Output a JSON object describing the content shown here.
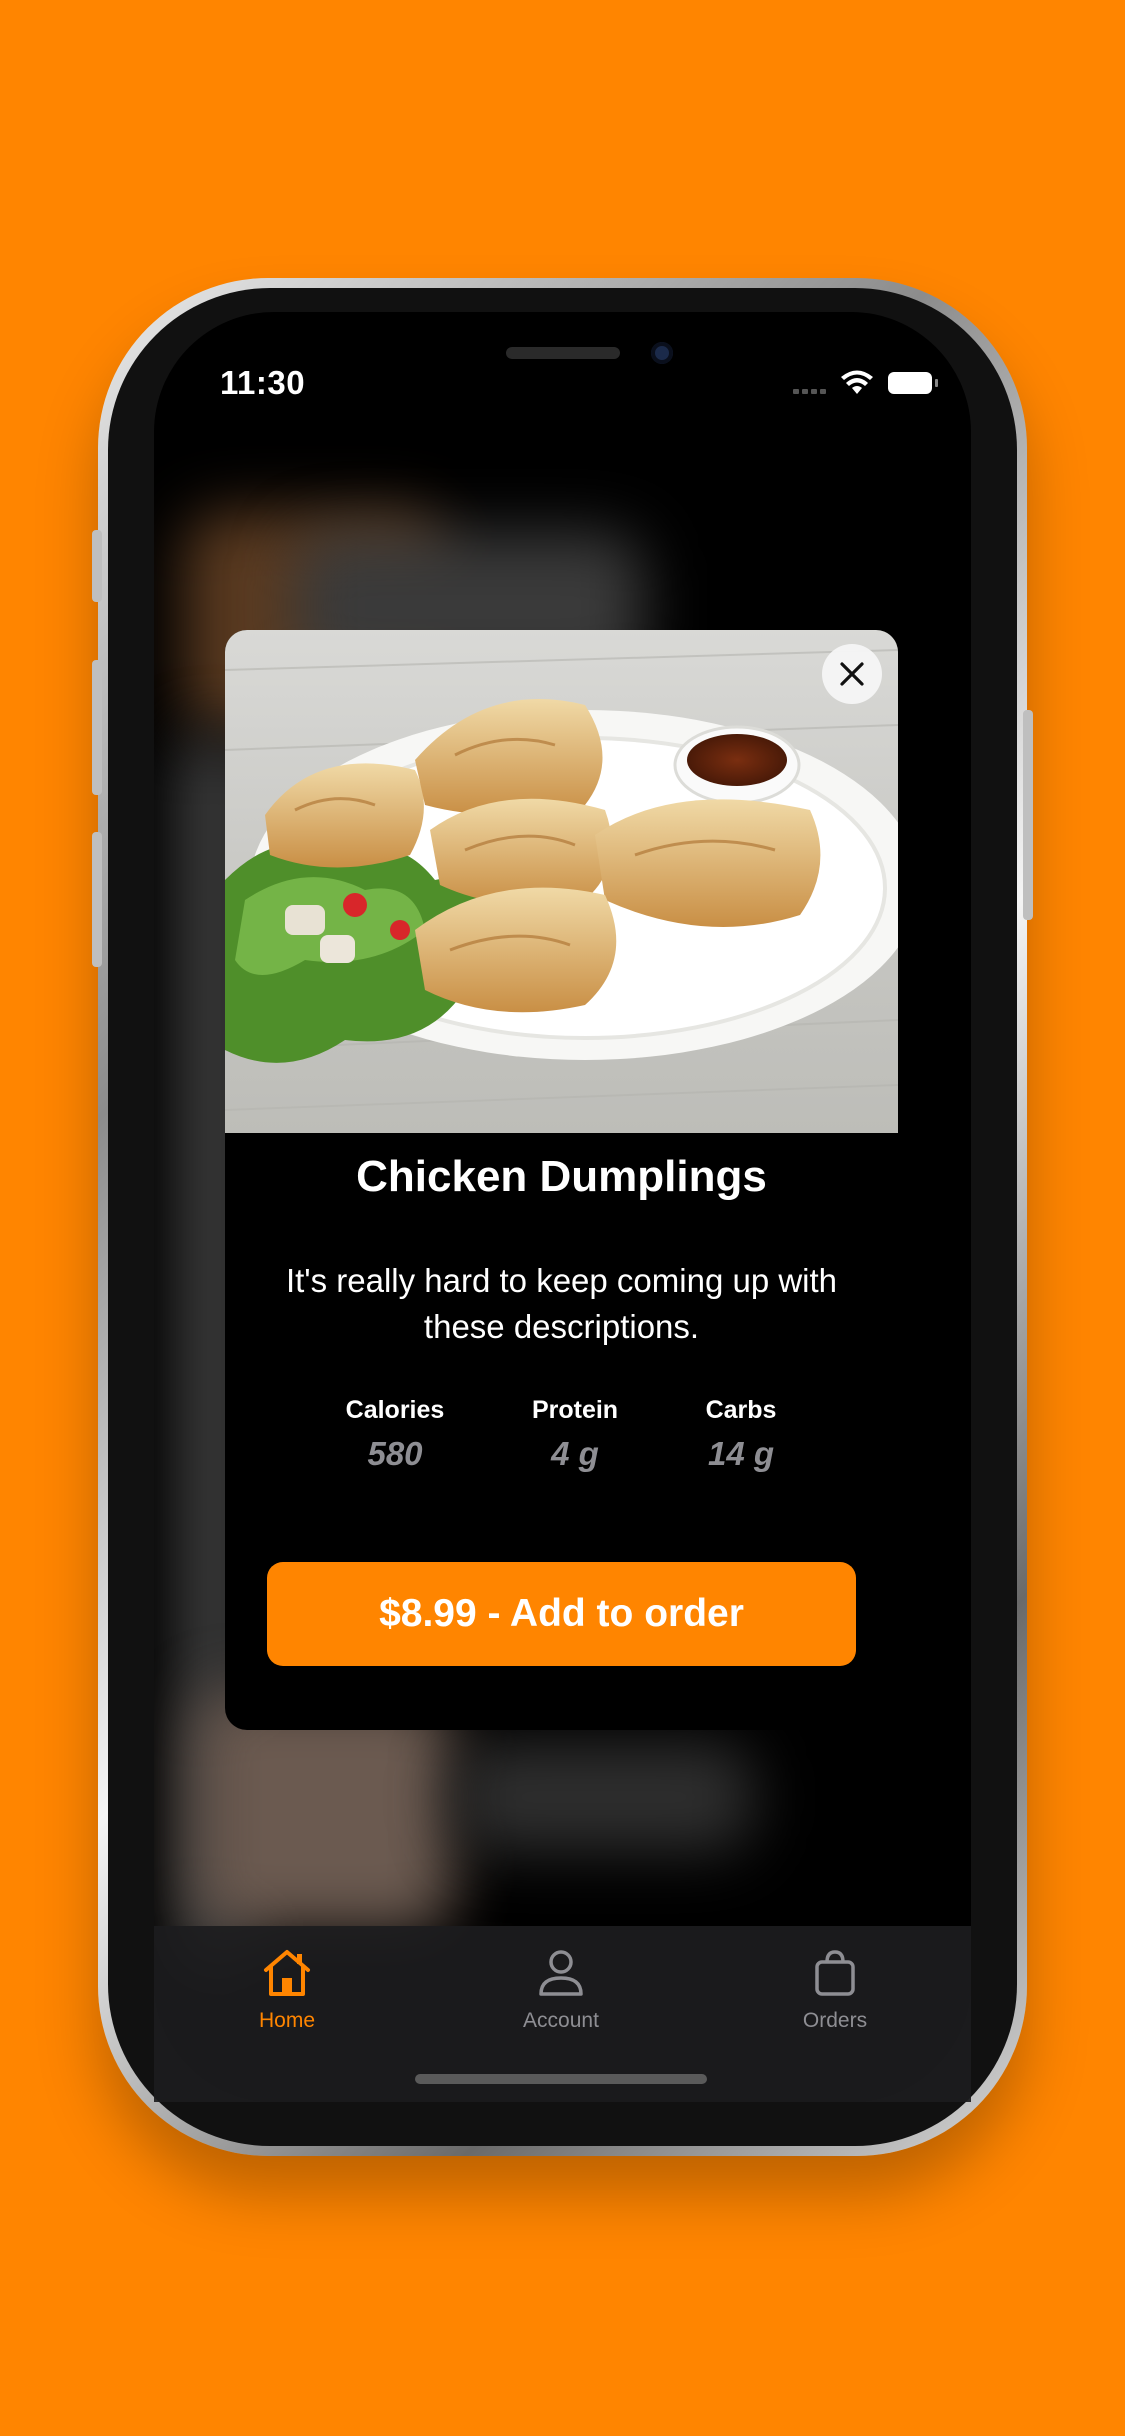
{
  "status_bar": {
    "time": "11:30"
  },
  "item": {
    "title": "Chicken Dumplings",
    "description": "It's really hard to keep coming up with these descriptions.",
    "nutrition": [
      {
        "label": "Calories",
        "value": "580"
      },
      {
        "label": "Protein",
        "value": "4 g"
      },
      {
        "label": "Carbs",
        "value": "14 g"
      }
    ],
    "add_button_label": "$8.99 - Add to order"
  },
  "tabs": [
    {
      "label": "Home",
      "icon": "home-icon",
      "active": true
    },
    {
      "label": "Account",
      "icon": "person-icon",
      "active": false
    },
    {
      "label": "Orders",
      "icon": "bag-icon",
      "active": false
    }
  ],
  "colors": {
    "accent": "#FF8500",
    "inactive_tab": "#8e8e93",
    "muted_value": "#8e8e93"
  }
}
